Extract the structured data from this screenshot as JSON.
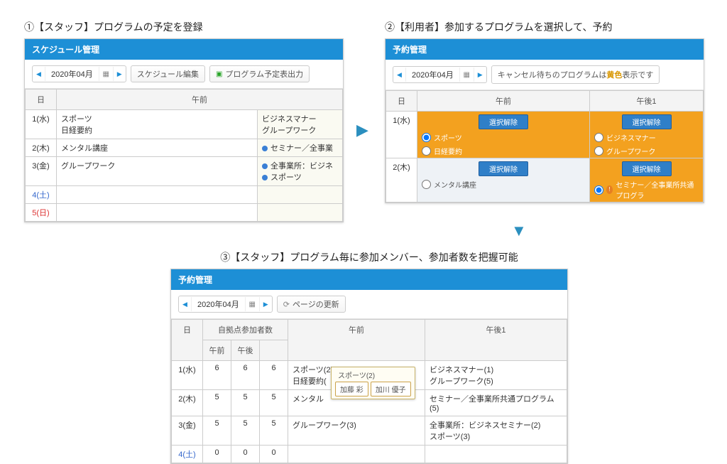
{
  "captions": {
    "c1": "①【スタッフ】プログラムの予定を登録",
    "c2": "②【利用者】参加するプログラムを選択して、予約",
    "c3": "③【スタッフ】プログラム毎に参加メンバー、参加者数を把握可能"
  },
  "panel1": {
    "title": "スケジュール管理",
    "date": "2020年04月",
    "btn_edit": "スケジュール編集",
    "btn_export": "プログラム予定表出力",
    "col_day": "日",
    "col_am": "午前",
    "rows": [
      {
        "day": "1(水)",
        "am": "スポーツ\n日経要約",
        "pm": "ビジネスマナー\nグループワーク",
        "pm_bullet": false
      },
      {
        "day": "2(木)",
        "am": "メンタル講座",
        "pm": "セミナー／全事業",
        "pm_bullet": true
      },
      {
        "day": "3(金)",
        "am": "グループワーク",
        "pm": "全事業所：ビジネ\nスポーツ",
        "pm_bullet": true
      },
      {
        "day": "4(土)",
        "am": "",
        "pm": "",
        "cls": "sat"
      },
      {
        "day": "5(日)",
        "am": "",
        "pm": "",
        "cls": "sun"
      }
    ]
  },
  "panel2": {
    "title": "予約管理",
    "date": "2020年04月",
    "notice_pre": "キャンセル待ちのプログラムは",
    "notice_hl": "黄色",
    "notice_post": "表示です",
    "col_day": "日",
    "col_am": "午前",
    "col_pm": "午後1",
    "sel_btn": "選択解除",
    "row1": {
      "day": "1(水)",
      "am_opts": [
        "スポーツ",
        "日経要約"
      ],
      "am_checked": 0,
      "pm_opts": [
        "ビジネスマナー",
        "グループワーク"
      ]
    },
    "row2": {
      "day": "2(木)",
      "am_opts": [
        "メンタル講座"
      ],
      "pm_opts": [
        "セミナー／全事業所共通プログラ"
      ],
      "pm_checked": 0
    }
  },
  "panel3": {
    "title": "予約管理",
    "date": "2020年04月",
    "btn_refresh": "ページの更新",
    "col_day": "日",
    "col_count_group": "自拠点参加者数",
    "col_am_sub": "午前",
    "col_pm_sub": "午後",
    "col_am": "午前",
    "col_pm": "午後1",
    "tooltip": {
      "title": "スポーツ(2)",
      "names": [
        "加藤 彩",
        "加川 優子"
      ]
    },
    "rows": [
      {
        "day": "1(水)",
        "n1": "6",
        "n2": "6",
        "n3": "6",
        "am": [
          "スポーツ(2)",
          "日経要約("
        ],
        "pm": [
          "ビジネスマナー(1)",
          "グループワーク(5)"
        ]
      },
      {
        "day": "2(木)",
        "n1": "5",
        "n2": "5",
        "n3": "5",
        "am": [
          "メンタル"
        ],
        "pm": [
          "セミナー／全事業所共通プログラム(5)"
        ]
      },
      {
        "day": "3(金)",
        "n1": "5",
        "n2": "5",
        "n3": "5",
        "am": [
          "グループワーク(3)"
        ],
        "pm": [
          "全事業所：ビジネスセミナー(2)",
          "スポーツ(3)"
        ]
      },
      {
        "day": "4(土)",
        "n1": "0",
        "n2": "0",
        "n3": "0",
        "am": [],
        "pm": [],
        "cls": "sat"
      }
    ]
  }
}
